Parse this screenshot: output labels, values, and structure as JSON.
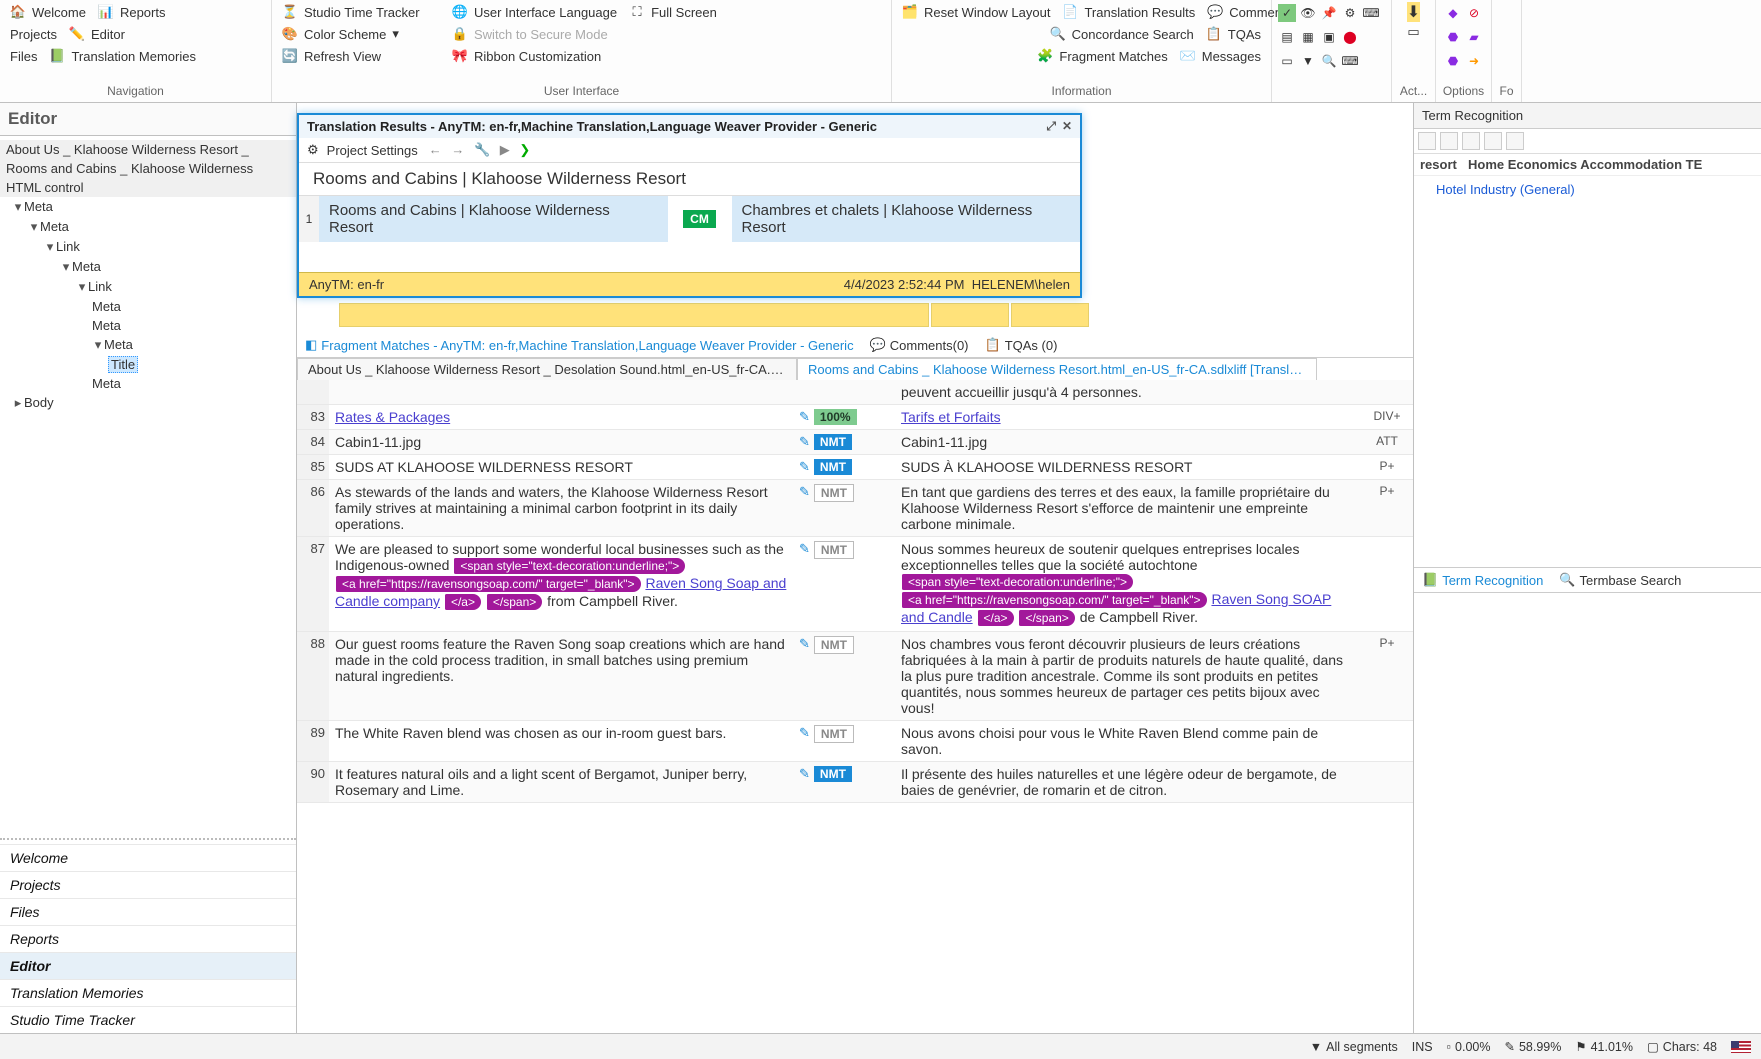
{
  "ribbon": {
    "nav": {
      "welcome": "Welcome",
      "reports": "Reports",
      "projects": "Projects",
      "editor": "Editor",
      "files": "Files",
      "tm": "Translation Memories",
      "label": "Navigation"
    },
    "ui": {
      "stt": "Studio Time Tracker",
      "uilang": "User Interface Language",
      "fullscreen": "Full Screen",
      "colorscheme": "Color Scheme",
      "secure": "Switch to Secure Mode",
      "refresh": "Refresh View",
      "ribboncust": "Ribbon Customization",
      "label": "User Interface"
    },
    "info": {
      "reset": "Reset Window Layout",
      "tr": "Translation Results",
      "comments": "Comments",
      "conc": "Concordance Search",
      "tqa": "TQAs",
      "frag": "Fragment Matches",
      "msg": "Messages",
      "label": "Information"
    },
    "act": {
      "label": "Act..."
    },
    "opt": {
      "label": "Options"
    },
    "fo": {
      "label": "Fo"
    }
  },
  "left": {
    "title": "Editor",
    "tabs": {
      "t1": "About Us _ Klahoose Wilderness Resort _",
      "t2": "Rooms and Cabins _ Klahoose Wilderness",
      "t3": "HTML control"
    },
    "tree": {
      "meta1": "Meta",
      "meta2": "Meta",
      "link1": "Link",
      "meta3": "Meta",
      "link2": "Link",
      "meta4": "Meta",
      "meta5": "Meta",
      "meta6": "Meta",
      "title": "Title",
      "meta7": "Meta",
      "body": "Body"
    },
    "nav": {
      "welcome": "Welcome",
      "projects": "Projects",
      "files": "Files",
      "reports": "Reports",
      "editor": "Editor",
      "tm": "Translation Memories",
      "stt": "Studio Time Tracker"
    }
  },
  "trwin": {
    "title": "Translation Results - AnyTM: en-fr,Machine Translation,Language Weaver Provider - Generic",
    "settings": "Project Settings",
    "heading": "Rooms and Cabins | Klahoose Wilderness Resort",
    "idx": "1",
    "src": "Rooms and Cabins | Klahoose Wilderness Resort",
    "cm": "CM",
    "tgt": "Chambres et chalets | Klahoose Wilderness Resort",
    "footer_l": "AnyTM: en-fr",
    "footer_dt": "4/4/2023 2:52:44 PM",
    "footer_user": "HELENEM\\helen"
  },
  "tabs": {
    "frag": "Fragment Matches - AnyTM: en-fr,Machine Translation,Language Weaver Provider - Generic",
    "comments": "Comments(0)",
    "tqas": "TQAs (0)",
    "term": "Term Recognition",
    "tbsearch": "Termbase Search"
  },
  "files": {
    "f1": "About Us _ Klahoose Wilderness Resort _ Desolation Sound.html_en-US_fr-CA.sdlxliff [Translation]",
    "f2": "Rooms and Cabins _ Klahoose Wilderness Resort.html_en-US_fr-CA.sdlxliff [Translation]"
  },
  "rows": {
    "pre": {
      "tgt": "peuvent accueillir jusqu'à 4 personnes."
    },
    "r83": {
      "n": "83",
      "src": "Rates & Packages",
      "pct": "100%",
      "tgt": "Tarifs et Forfaits",
      "ctx": "DIV+"
    },
    "r84": {
      "n": "84",
      "src": "Cabin1-11.jpg",
      "b": "NMT",
      "tgt": "Cabin1-11.jpg",
      "ctx": "ATT"
    },
    "r85": {
      "n": "85",
      "src": "SUDS AT KLAHOOSE WILDERNESS RESORT",
      "b": "NMT",
      "tgt": "SUDS À KLAHOOSE WILDERNESS RESORT",
      "ctx": "P+"
    },
    "r86": {
      "n": "86",
      "src": "As stewards of the lands and waters, the Klahoose Wilderness Resort family strives at maintaining a minimal carbon footprint in its daily operations.",
      "b": "NMT",
      "tgt": "En tant que gardiens des terres et des eaux, la famille propriétaire du Klahoose Wilderness Resort s'efforce de maintenir une empreinte carbone minimale.",
      "ctx": "P+"
    },
    "r87": {
      "n": "87",
      "src_a": "We are pleased to support some wonderful local businesses such as the Indigenous-owned ",
      "tag_span": "<span style=\"text-decoration:underline;\">",
      "tag_href": "<a href=\"https://ravensongsoap.com/\" target=\"_blank\">",
      "src_link": "Raven Song Soap and Candle company",
      "tag_a": "</a>",
      "tag_sp": "</span>",
      "src_b": " from Campbell River.",
      "b": "NMT",
      "tgt_a": "Nous sommes heureux de soutenir quelques entreprises locales exceptionnelles telles que la société autochtone ",
      "tgt_link": "Raven Song SOAP and Candle",
      "tgt_b": " de Campbell River.",
      "ctx": ""
    },
    "r88": {
      "n": "88",
      "src": "Our guest rooms feature the Raven Song soap creations which are hand made in the cold process tradition, in small batches using premium natural ingredients.",
      "b": "NMT",
      "tgt": "Nos chambres vous feront découvrir plusieurs de leurs créations fabriquées à la main à partir de produits naturels de haute qualité, dans la plus pure tradition ancestrale. Comme ils sont produits en petites quantités, nous sommes heureux de partager ces petits bijoux avec vous!",
      "ctx": "P+"
    },
    "r89": {
      "n": "89",
      "src": "The White Raven blend was chosen as our in-room guest bars.",
      "b": "NMT",
      "tgt": "Nous avons choisi pour vous le White Raven Blend comme pain de savon.",
      "ctx": ""
    },
    "r90": {
      "n": "90",
      "src": "It features natural oils and a light scent of Bergamot, Juniper berry, Rosemary and Lime.",
      "b": "NMT",
      "tgt": "Il présente des huiles naturelles et une légère odeur de bergamote, de baies de genévrier, de romarin et de citron.",
      "ctx": ""
    }
  },
  "term": {
    "title": "Term Recognition",
    "col1": "resort",
    "col2": "Home Economics Accommodation TE",
    "entry": "Hotel Industry (General)"
  },
  "status": {
    "filter": "All segments",
    "ins": "INS",
    "pct0": "0.00%",
    "pct1": "58.99%",
    "pct2": "41.01%",
    "chars": "Chars: 48"
  }
}
